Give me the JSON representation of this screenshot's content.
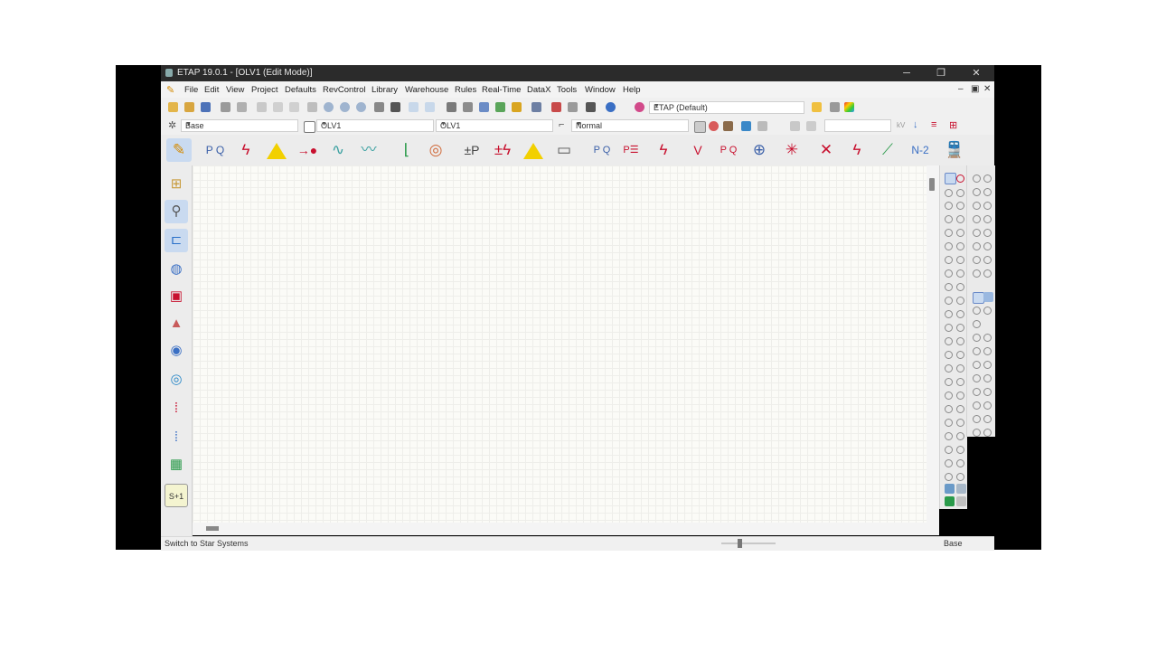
{
  "window": {
    "title": "ETAP 19.0.1 - [OLV1 (Edit Mode)]"
  },
  "window_controls": {
    "minimize": "─",
    "restore": "❐",
    "close": "✕"
  },
  "mdi_controls": {
    "minimize": "–",
    "restore": "▣",
    "close": "✕"
  },
  "menu": [
    "File",
    "Edit",
    "View",
    "Project",
    "Defaults",
    "RevControl",
    "Library",
    "Warehouse",
    "Rules",
    "Real-Time",
    "DataX",
    "Tools",
    "Window",
    "Help"
  ],
  "toolbar1": {
    "theme_label": "ETAP (Default)"
  },
  "toolbar2": {
    "presentation": "Base",
    "config": "OLV1",
    "revision": "OLV1",
    "mode": "Normal",
    "kv_label": "kV"
  },
  "toolbar3": {
    "n2_label": "N-2"
  },
  "lefttb": {
    "sld_label": "S+1"
  },
  "status": {
    "message": "Switch to Star Systems",
    "base": "Base"
  },
  "colors": {
    "titlebar": "#2b2b2b",
    "canvas": "#fbfbf7",
    "accent_red": "#c8102e",
    "accent_yellow": "#f2d000"
  }
}
